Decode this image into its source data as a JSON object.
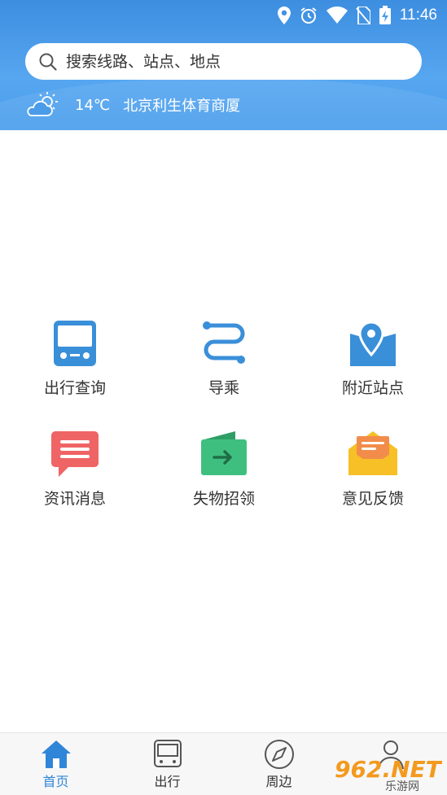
{
  "status_bar": {
    "time": "11:46"
  },
  "search": {
    "placeholder": "搜索线路、站点、地点"
  },
  "weather": {
    "temperature": "14℃",
    "location": "北京利生体育商厦"
  },
  "menu": [
    {
      "label": "出行查询",
      "icon": "bus-icon",
      "color": "#3a8fd9"
    },
    {
      "label": "导乘",
      "icon": "route-icon",
      "color": "#3a8fd9"
    },
    {
      "label": "附近站点",
      "icon": "map-pin-icon",
      "color": "#3a8fd9"
    },
    {
      "label": "资讯消息",
      "icon": "message-icon",
      "color": "#ef6464"
    },
    {
      "label": "失物招领",
      "icon": "wallet-icon",
      "color": "#3fbf7f"
    },
    {
      "label": "意见反馈",
      "icon": "mail-icon",
      "color": "#f6c026"
    }
  ],
  "tabs": [
    {
      "label": "首页",
      "icon": "home-icon",
      "active": true
    },
    {
      "label": "出行",
      "icon": "bus-outline-icon",
      "active": false
    },
    {
      "label": "周边",
      "icon": "compass-icon",
      "active": false
    },
    {
      "label": "",
      "icon": "user-icon",
      "active": false
    }
  ],
  "watermark": {
    "text": "962.NET",
    "sub": "乐游网"
  },
  "colors": {
    "header": "#4a9ce8",
    "accent": "#2f86d8"
  }
}
